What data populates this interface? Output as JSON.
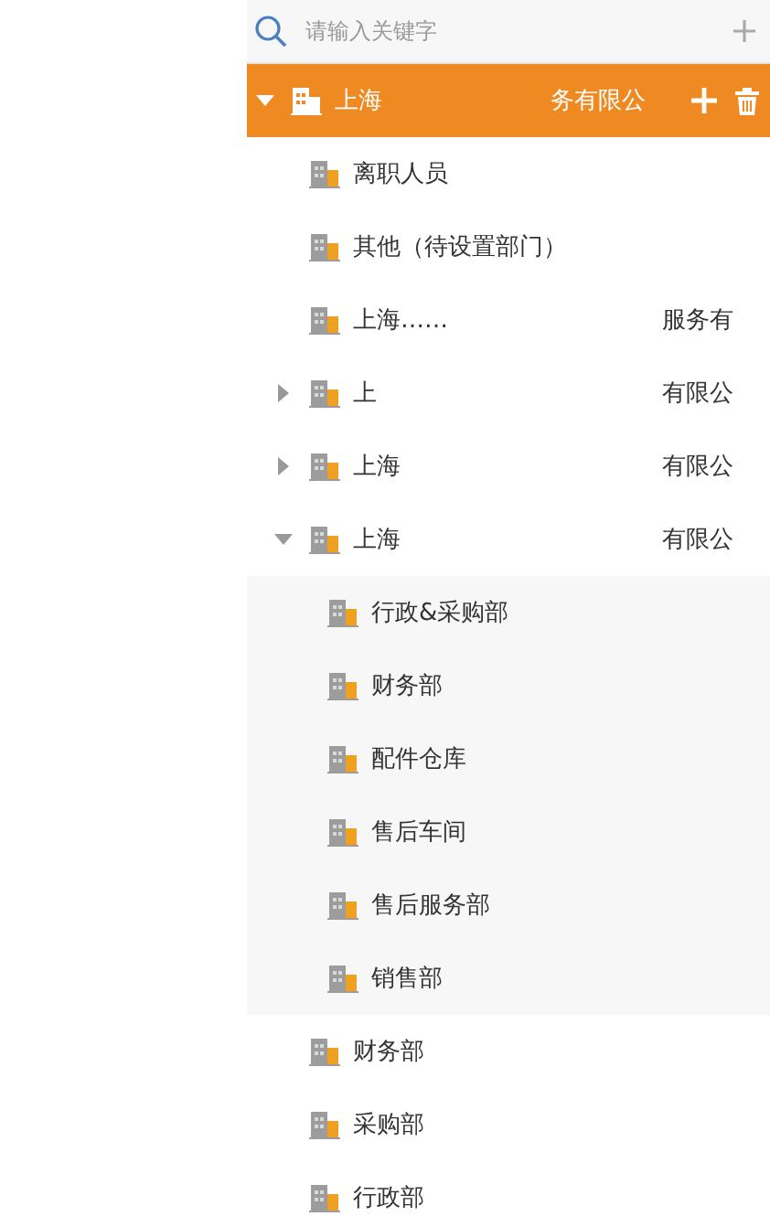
{
  "search": {
    "placeholder": "请输入关键字"
  },
  "tree": [
    {
      "label_parts": [
        "上海",
        "务有限公"
      ],
      "expanded": true,
      "selected": true,
      "children": [
        {
          "label_parts": [
            "离职人员"
          ]
        },
        {
          "label_parts": [
            "其他（待设置部门）"
          ]
        },
        {
          "label_parts": [
            "上海……",
            "服务有"
          ]
        },
        {
          "label_parts": [
            "上",
            "有限公"
          ],
          "expanded": false
        },
        {
          "label_parts": [
            "上海",
            "有限公"
          ],
          "expanded": false
        },
        {
          "label_parts": [
            "上海",
            "有限公"
          ],
          "expanded": true,
          "children": [
            {
              "label_parts": [
                "行政&采购部"
              ]
            },
            {
              "label_parts": [
                "财务部"
              ]
            },
            {
              "label_parts": [
                "配件仓库"
              ]
            },
            {
              "label_parts": [
                "售后车间"
              ]
            },
            {
              "label_parts": [
                "售后服务部"
              ]
            },
            {
              "label_parts": [
                "销售部"
              ]
            }
          ]
        },
        {
          "label_parts": [
            "财务部"
          ]
        },
        {
          "label_parts": [
            "采购部"
          ]
        },
        {
          "label_parts": [
            "行政部"
          ]
        }
      ]
    }
  ]
}
